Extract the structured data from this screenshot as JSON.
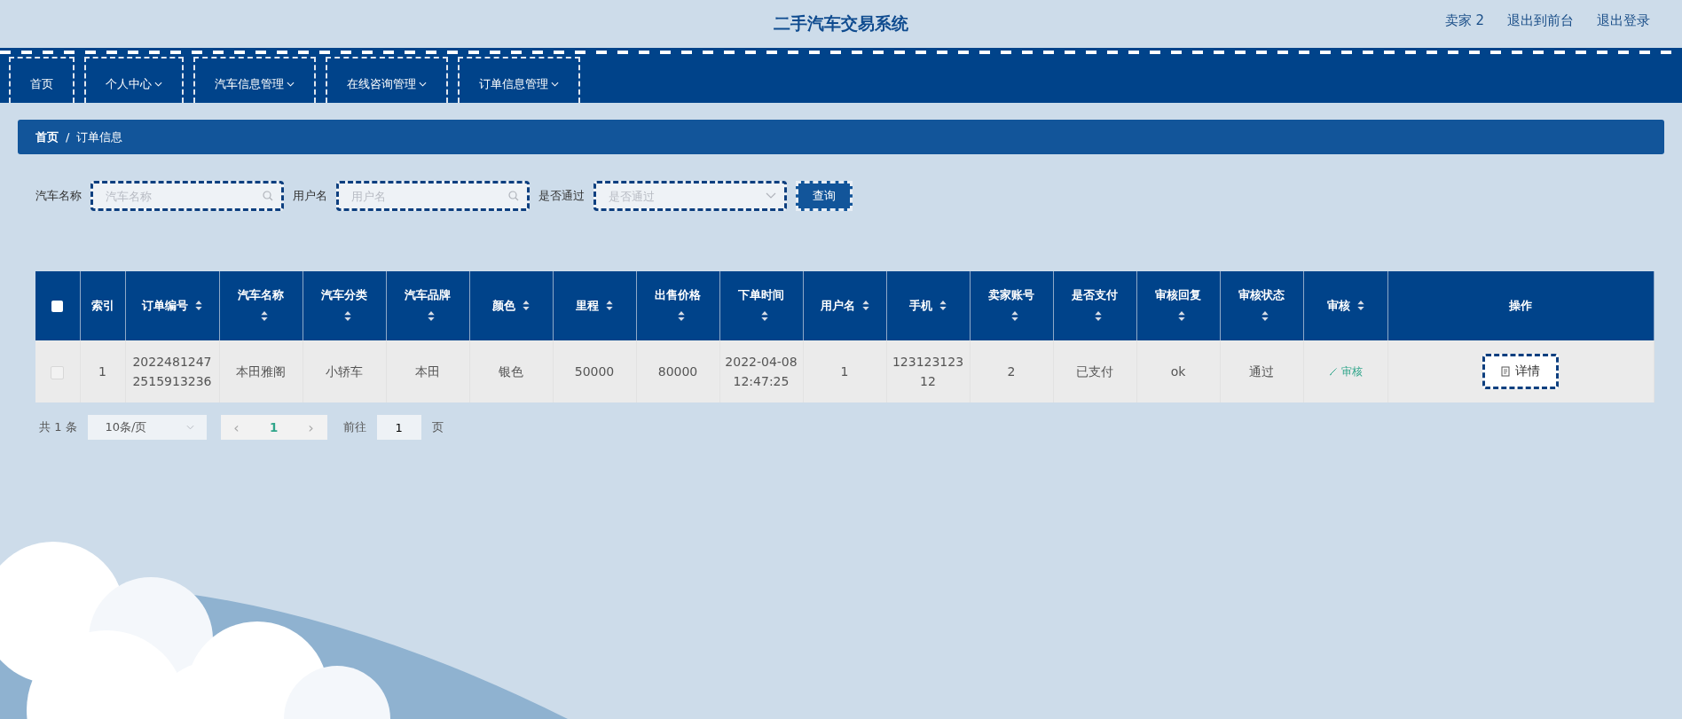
{
  "header": {
    "title": "二手汽车交易系统",
    "links": [
      "卖家 2",
      "退出到前台",
      "退出登录"
    ]
  },
  "nav": [
    {
      "label": "首页",
      "dropdown": false
    },
    {
      "label": "个人中心",
      "dropdown": true
    },
    {
      "label": "汽车信息管理",
      "dropdown": true
    },
    {
      "label": "在线咨询管理",
      "dropdown": true
    },
    {
      "label": "订单信息管理",
      "dropdown": true
    }
  ],
  "breadcrumb": [
    "首页",
    "订单信息"
  ],
  "breadcrumb_separator": "/",
  "search": {
    "fields": [
      {
        "label": "汽车名称",
        "placeholder": "汽车名称",
        "kind": "input"
      },
      {
        "label": "用户名",
        "placeholder": "用户名",
        "kind": "input"
      },
      {
        "label": "是否通过",
        "placeholder": "是否通过",
        "kind": "select"
      }
    ],
    "button": "查询"
  },
  "table": {
    "select_all": {
      "checked": false
    },
    "columns": [
      {
        "label": "索引",
        "sortable": false
      },
      {
        "label": "订单编号",
        "sortable": true
      },
      {
        "label": "汽车名称",
        "sortable": true
      },
      {
        "label": "汽车分类",
        "sortable": true
      },
      {
        "label": "汽车品牌",
        "sortable": true
      },
      {
        "label": "颜色",
        "sortable": true
      },
      {
        "label": "里程",
        "sortable": true
      },
      {
        "label": "出售价格",
        "sortable": true
      },
      {
        "label": "下单时间",
        "sortable": true
      },
      {
        "label": "用户名",
        "sortable": true
      },
      {
        "label": "手机",
        "sortable": true
      },
      {
        "label": "卖家账号",
        "sortable": true
      },
      {
        "label": "是否支付",
        "sortable": true
      },
      {
        "label": "审核回复",
        "sortable": true
      },
      {
        "label": "审核状态",
        "sortable": true
      },
      {
        "label": "审核",
        "sortable": true
      },
      {
        "label": "操作",
        "sortable": false
      }
    ],
    "rows": [
      {
        "checked": false,
        "cells": [
          "1",
          "20224812472515913236",
          "本田雅阁",
          "小轿车",
          "本田",
          "银色",
          "50000",
          "80000",
          "2022-04-08 12:47:25",
          "1",
          "12312312312",
          "2",
          "已支付",
          "ok",
          "通过"
        ],
        "review_link": "审核",
        "action": "详情"
      }
    ]
  },
  "pagination": {
    "total": "共 1 条",
    "page_size": "10条/页",
    "prev": "‹",
    "pages": [
      {
        "label": "1",
        "selected": true
      }
    ],
    "next": "›",
    "goto_label": "前往",
    "goto_value": "1",
    "goto_suffix": "页"
  }
}
